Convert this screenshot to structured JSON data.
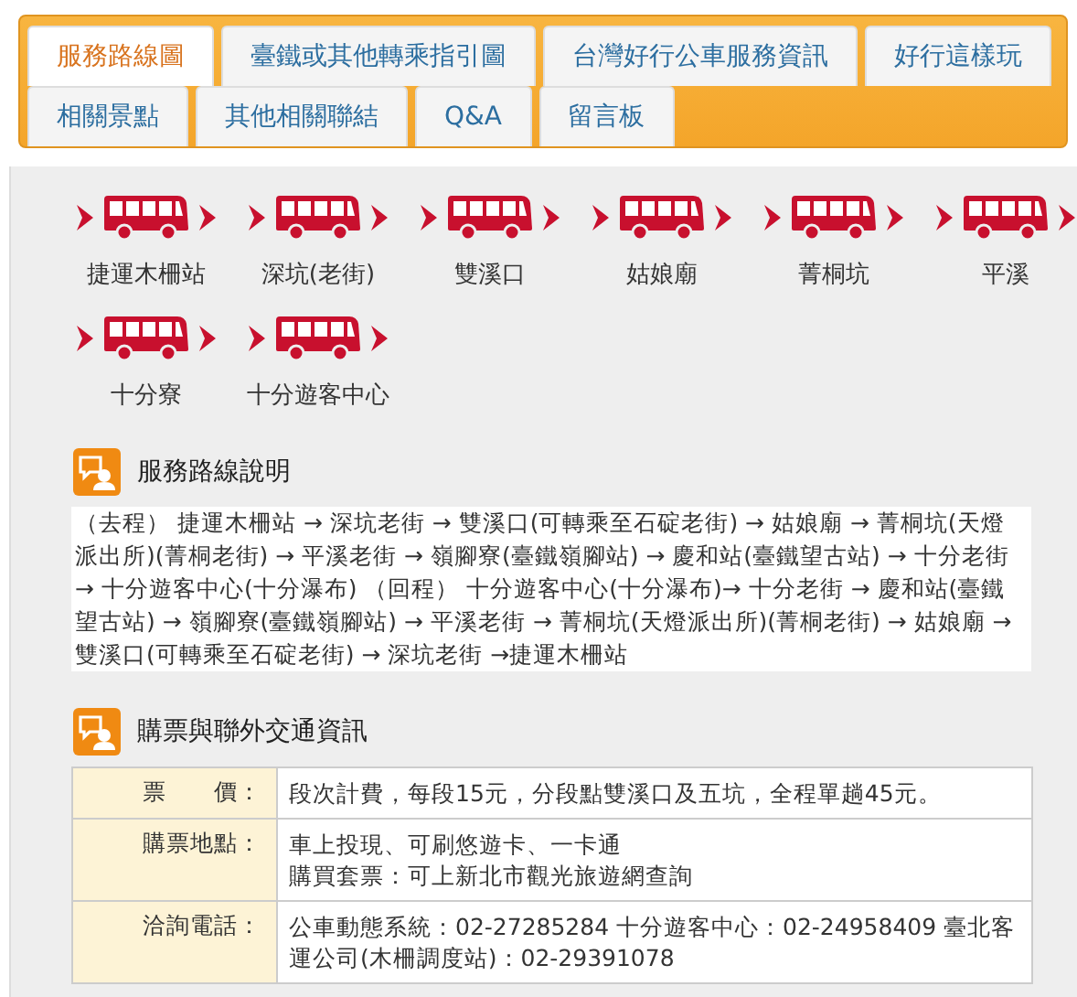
{
  "tab_rows": [
    {
      "tabs": [
        {
          "label": "服務路線圖",
          "selected": true
        },
        {
          "label": "臺鐵或其他轉乘指引圖",
          "selected": false
        },
        {
          "label": "台灣好行公車服務資訊",
          "selected": false
        },
        {
          "label": "好行這樣玩",
          "selected": false
        }
      ]
    },
    {
      "tabs": [
        {
          "label": "相關景點",
          "selected": false
        },
        {
          "label": "其他相關聯結",
          "selected": false
        },
        {
          "label": "Q&A",
          "selected": false
        },
        {
          "label": "留言板",
          "selected": false
        }
      ]
    }
  ],
  "stops": [
    "捷運木柵站",
    "深坑(老街)",
    "雙溪口",
    "姑娘廟",
    "菁桐坑",
    "平溪",
    "十分寮",
    "十分遊客中心"
  ],
  "route_description": {
    "title": "服務路線說明",
    "text": "（去程） 捷運木柵站 → 深坑老街 → 雙溪口(可轉乘至石碇老街) → 姑娘廟 → 菁桐坑(天燈派出所)(菁桐老街) → 平溪老街 → 嶺腳寮(臺鐵嶺腳站) → 慶和站(臺鐵望古站) → 十分老街 → 十分遊客中心(十分瀑布) （回程） 十分遊客中心(十分瀑布)→ 十分老街 → 慶和站(臺鐵望古站) → 嶺腳寮(臺鐵嶺腳站) → 平溪老街 → 菁桐坑(天燈派出所)(菁桐老街) → 姑娘廟 → 雙溪口(可轉乘至石碇老街) → 深坑老街 →捷運木柵站"
  },
  "ticket_info": {
    "title": "購票與聯外交通資訊",
    "rows": [
      {
        "label": "票　　價：",
        "lines": [
          "段次計費，每段15元，分段點雙溪口及五坑，全程單趟45元。"
        ]
      },
      {
        "label": "購票地點：",
        "lines": [
          "車上投現、可刷悠遊卡、一卡通",
          "購買套票：可上新北市觀光旅遊網查詢"
        ]
      },
      {
        "label": "洽詢電話：",
        "lines": [
          "公車動態系統：02-27285284 十分遊客中心：02-24958409 臺北客運公司(木柵調度站)：02-29391078"
        ]
      }
    ]
  }
}
